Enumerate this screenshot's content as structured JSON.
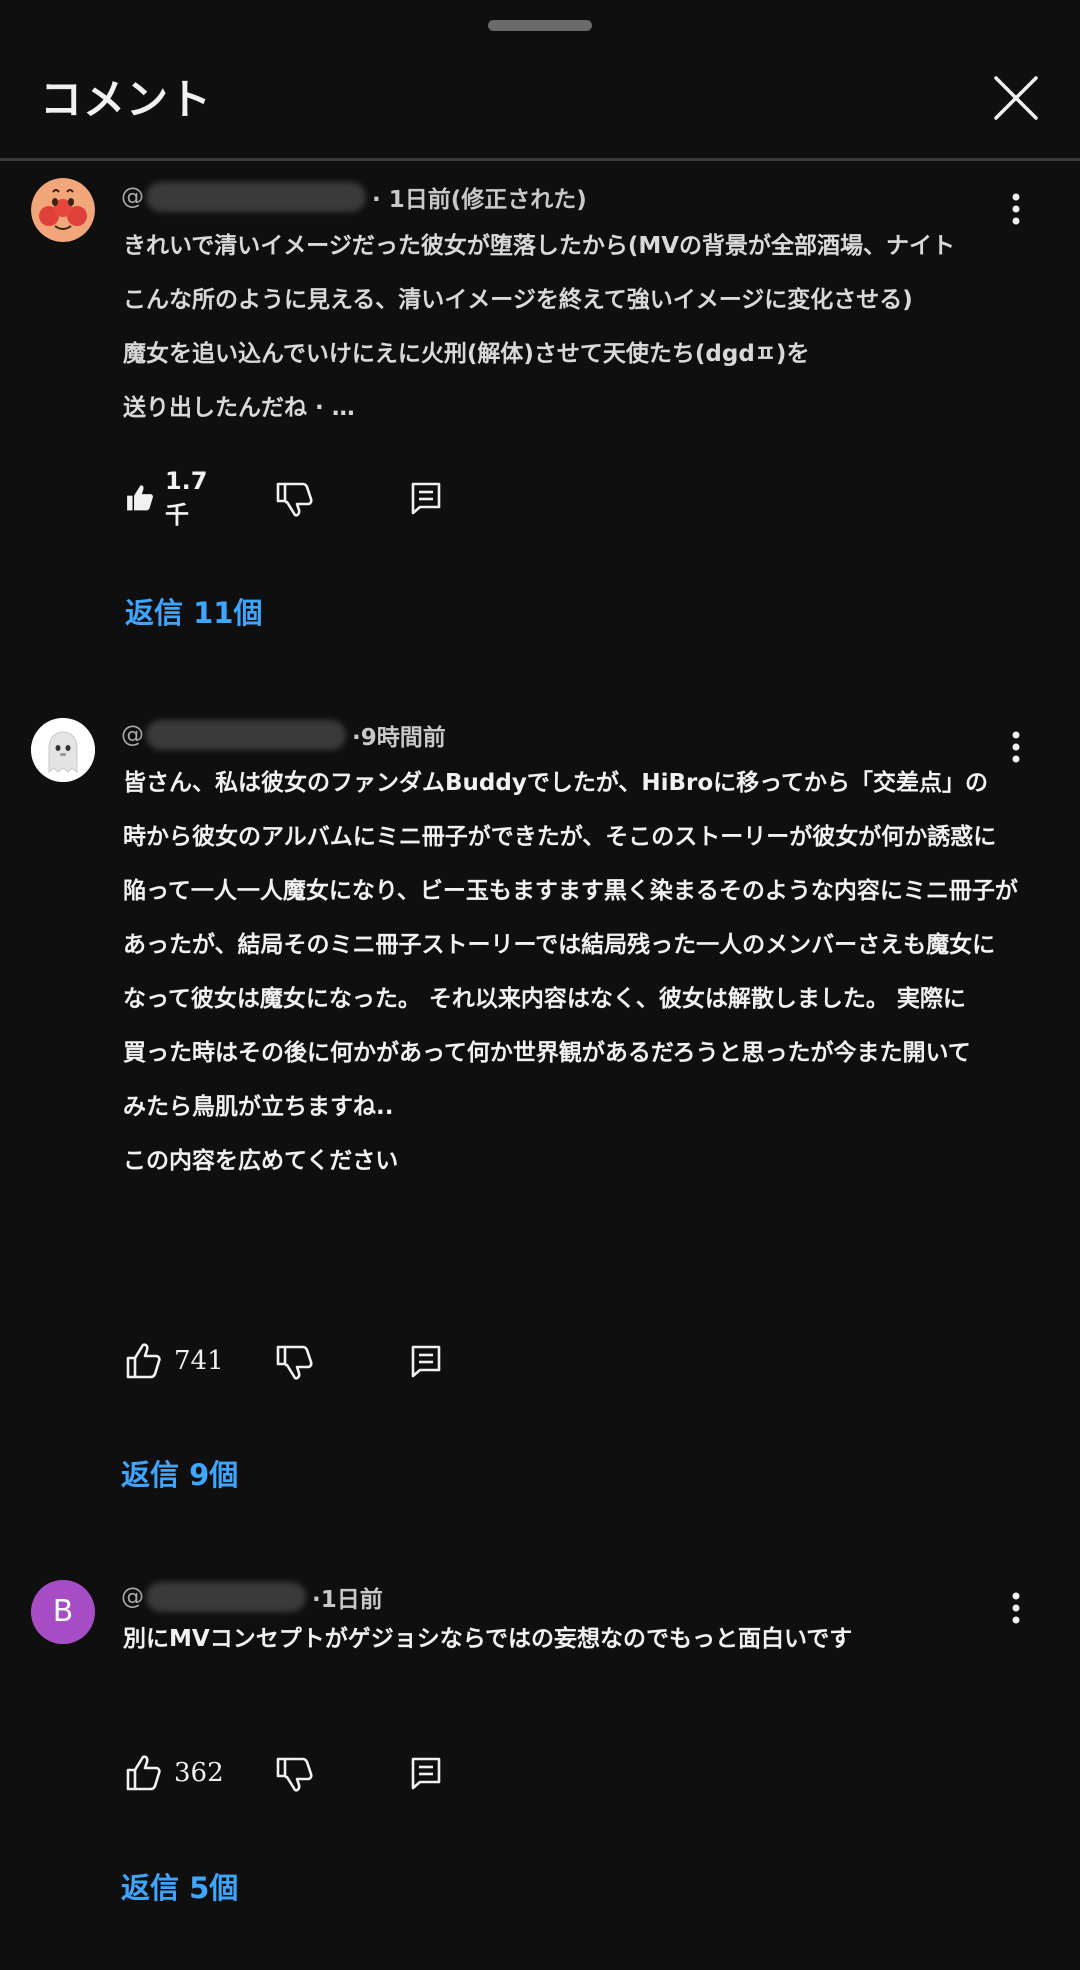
{
  "header": {
    "title": "コメント",
    "close_icon": "close-icon"
  },
  "comments": [
    {
      "handle_prefix": "@",
      "time": "· 1日前(修正された)",
      "avatar": {
        "kind": "character-face",
        "colors": {
          "skin": "#f2a77b",
          "cheek": "#e0403a"
        }
      },
      "lines": [
        "きれいで清いイメージだった彼女が堕落したから(MVの背景が全部酒場、ナイト",
        "こんな所のように見える、清いイメージを終えて強いイメージに変化させる)",
        "魔女を追い込んでいけにえに火刑(解体)させて天使たち(dgdㅍ)を",
        "送り出したんだね ·                      …"
      ],
      "likes": "1.7千",
      "replies": "返信 11個"
    },
    {
      "handle_prefix": "@",
      "time": "·9時間前",
      "avatar": {
        "kind": "ghost",
        "colors": {
          "bg": "#ffffff",
          "body": "#e8e8e8"
        }
      },
      "lines": [
        "皆さん、私は彼女のファンダムBuddyでしたが、HiBroに移ってから「交差点」の",
        "時から彼女のアルバムにミニ冊子ができたが、そこのストーリーが彼女が何か誘惑に",
        "陥って一人一人魔女になり、ビー玉もますます黒く染まるそのような内容にミニ冊子が",
        "あったが、結局そのミニ冊子ストーリーでは結局残った一人のメンバーさえも魔女に",
        "なって彼女は魔女になった。 それ以来内容はなく、彼女は解散しました。 実際に",
        "買った時はその後に何かがあって何か世界観があるだろうと思ったが今また開いて",
        "みたら鳥肌が立ちますね..",
        "この内容を広めてください"
      ],
      "likes": "741",
      "replies": "返信 9個"
    },
    {
      "handle_prefix": "@",
      "time": "·1日前",
      "avatar": {
        "kind": "letter",
        "letter": "B",
        "colors": {
          "bg": "#a64cc4"
        }
      },
      "lines": [
        "別にMVコンセプトがゲジョシならではの妄想なのでもっと面白いです"
      ],
      "likes": "362",
      "replies": "返信 5個"
    }
  ],
  "icons": {
    "like": "thumbs-up-icon",
    "dislike": "thumbs-down-icon",
    "reply": "reply-comment-icon",
    "more": "more-vertical-icon"
  },
  "colors": {
    "background": "#0f0f0f",
    "text": "#f1f1f1",
    "meta": "#aaaaaa",
    "link": "#3ea6ff"
  }
}
